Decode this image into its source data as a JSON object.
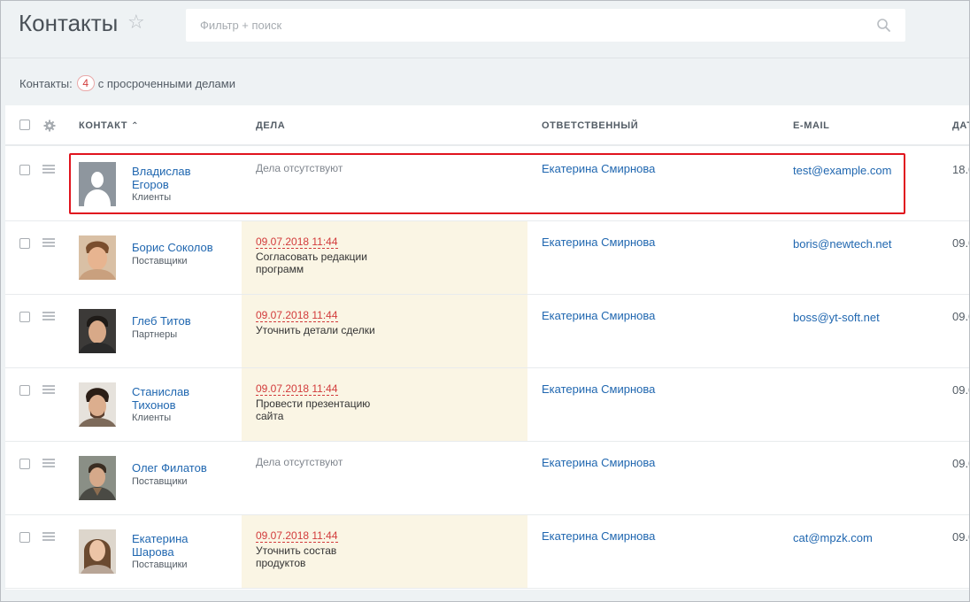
{
  "header": {
    "title": "Контакты",
    "search_placeholder": "Фильтр + поиск"
  },
  "counter": {
    "label": "Контакты:",
    "count": "4",
    "suffix": "с просроченными делами"
  },
  "table": {
    "columns": {
      "contact": "КОНТАКТ",
      "deals": "ДЕЛА",
      "responsible": "ОТВЕТСТВЕННЫЙ",
      "email": "E-MAIL",
      "date": "ДАТ"
    },
    "rows": [
      {
        "name_line1": "Владислав",
        "name_line2": "Егоров",
        "type": "Клиенты",
        "deal_date": "",
        "deal_text_line1": "",
        "deal_text_line2": "",
        "no_deals": "Дела отсутствуют",
        "responsible": "Екатерина Смирнова",
        "email": "test@example.com",
        "date": "18.0"
      },
      {
        "name_line1": "Борис Соколов",
        "name_line2": "",
        "type": "Поставщики",
        "deal_date": "09.07.2018 11:44",
        "deal_text_line1": "Согласовать редакции",
        "deal_text_line2": "программ",
        "no_deals": "",
        "responsible": "Екатерина Смирнова",
        "email": "boris@newtech.net",
        "date": "09.0"
      },
      {
        "name_line1": "Глеб Титов",
        "name_line2": "",
        "type": "Партнеры",
        "deal_date": "09.07.2018 11:44",
        "deal_text_line1": "Уточнить детали сделки",
        "deal_text_line2": "",
        "no_deals": "",
        "responsible": "Екатерина Смирнова",
        "email": "boss@yt-soft.net",
        "date": "09.0"
      },
      {
        "name_line1": "Станислав",
        "name_line2": "Тихонов",
        "type": "Клиенты",
        "deal_date": "09.07.2018 11:44",
        "deal_text_line1": "Провести презентацию",
        "deal_text_line2": "сайта",
        "no_deals": "",
        "responsible": "Екатерина Смирнова",
        "email": "",
        "date": "09.0"
      },
      {
        "name_line1": "Олег Филатов",
        "name_line2": "",
        "type": "Поставщики",
        "deal_date": "",
        "deal_text_line1": "",
        "deal_text_line2": "",
        "no_deals": "Дела отсутствуют",
        "responsible": "Екатерина Смирнова",
        "email": "",
        "date": "09.0"
      },
      {
        "name_line1": "Екатерина",
        "name_line2": "Шарова",
        "type": "Поставщики",
        "deal_date": "09.07.2018 11:44",
        "deal_text_line1": "Уточнить состав",
        "deal_text_line2": "продуктов",
        "no_deals": "",
        "responsible": "Екатерина Смирнова",
        "email": "cat@mpzk.com",
        "date": "09.0"
      }
    ]
  },
  "colors": {
    "link": "#2067b0",
    "overdue": "#d23b3b",
    "deal_highlight_bg": "#faf5e4",
    "selection_border": "#e0141e"
  }
}
